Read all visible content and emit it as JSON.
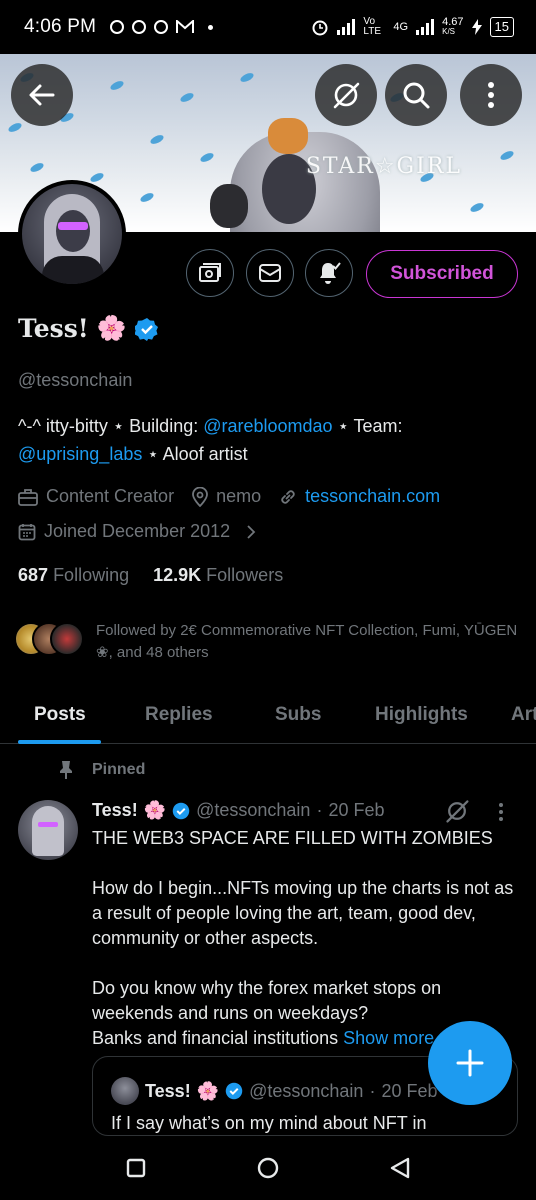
{
  "status_bar": {
    "time": "4:06 PM",
    "network_label": "Vo LTE",
    "network_type": "4G",
    "speed": "4.67",
    "speed_unit": "K/S",
    "battery": "15"
  },
  "header": {
    "back_icon": "arrow-left-icon",
    "grok_icon": "grok-icon",
    "search_icon": "search-icon",
    "more_icon": "more-vertical-icon",
    "banner_logo_text": "STAR☆GIRL"
  },
  "profile_actions": {
    "subscribe_label": "Subscribed",
    "accent_color": "#c936d4"
  },
  "profile": {
    "name": "Tess!",
    "name_emoji": "🌸",
    "handle": "@tessonchain",
    "bio_part1": "^-^ itty-bitty ⋆ Building: ",
    "bio_link1": "@rarebloomdao",
    "bio_part2": " ⋆ Team: ",
    "bio_link2": "@uprising_labs",
    "bio_part3": " ⋆ Aloof artist",
    "category": "Content Creator",
    "location": "nemo",
    "website": "tessonchain.com",
    "joined": "Joined December 2012",
    "following_count": "687",
    "following_label": "Following",
    "followers_count": "12.9K",
    "followers_label": "Followers",
    "followed_by": "Followed by 2€ Commemorative NFT Collection, Fumi, YŪGEN ❀, and 48 others"
  },
  "tabs": [
    {
      "label": "Posts",
      "active": true
    },
    {
      "label": "Replies",
      "active": false
    },
    {
      "label": "Subs",
      "active": false
    },
    {
      "label": "Highlights",
      "active": false
    },
    {
      "label": "Articles",
      "active": false
    }
  ],
  "pinned_post": {
    "pinned_label": "Pinned",
    "author_name": "Tess!",
    "author_emoji": "🌸",
    "handle": "@tessonchain",
    "date": "20 Feb",
    "line1": "THE WEB3 SPACE ARE FILLED WITH ZOMBIES",
    "para2": "How do I begin...NFTs moving up the charts is not as a result of people loving the art, team, good dev, community or other aspects.",
    "para3a": "Do you know why the forex market stops on weekends and runs on weekdays?",
    "para3b": "Banks and financial institutions ",
    "show_more": "Show more",
    "quote": {
      "author_name": "Tess!",
      "author_emoji": "🌸",
      "handle": "@tessonchain",
      "date": "20 Feb",
      "text": "If I say what’s on my mind about NFT in"
    }
  },
  "colors": {
    "link": "#1d9bf0",
    "muted": "#71767b",
    "verified": "#1d9bf0"
  }
}
